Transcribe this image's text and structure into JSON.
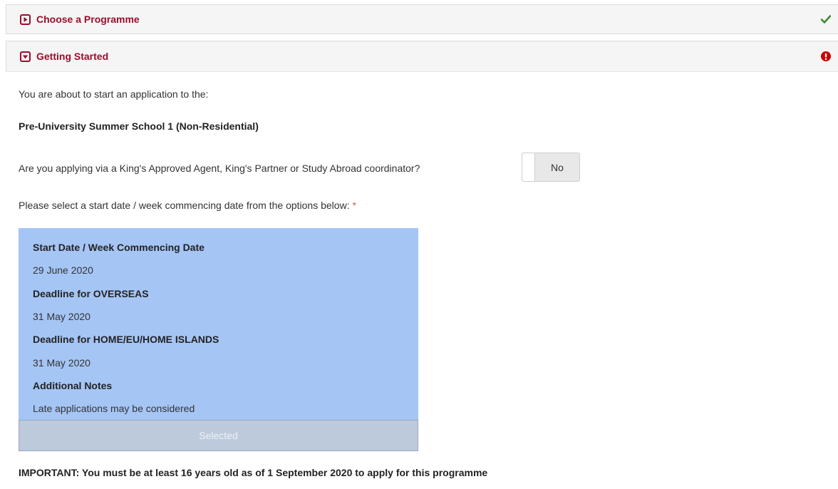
{
  "panels": [
    {
      "title": "Choose a Programme",
      "status": "complete",
      "icon": "expand-icon",
      "status_icon": "checkmark-icon"
    },
    {
      "title": "Getting Started",
      "status": "error",
      "icon": "collapse-icon",
      "status_icon": "exclamation-icon"
    }
  ],
  "colors": {
    "accent": "#9b0d2b",
    "check": "#3d8a35",
    "error": "#cc0000",
    "selected_card": "#a5c5f5"
  },
  "content": {
    "intro": "You are about to start an application to the:",
    "programme_name": "Pre-University Summer School 1 (Non-Residential)",
    "agent_question": "Are you applying via a King's Approved Agent, King's Partner or Study Abroad coordinator?",
    "agent_toggle_value": "No",
    "date_prompt": "Please select a start date / week commencing date from the options below:",
    "required_marker": "*",
    "date_option": {
      "start_label": "Start Date / Week Commencing Date",
      "start_value": "29 June 2020",
      "overseas_label": "Deadline for OVERSEAS",
      "overseas_value": "31 May 2020",
      "home_label": "Deadline for HOME/EU/HOME ISLANDS",
      "home_value": "31 May 2020",
      "notes_label": "Additional Notes",
      "notes_value": "Late applications may be considered",
      "button_label": "Selected"
    },
    "important": "IMPORTANT: You must be at least 16 years old as of 1 September 2020 to apply for this programme"
  }
}
